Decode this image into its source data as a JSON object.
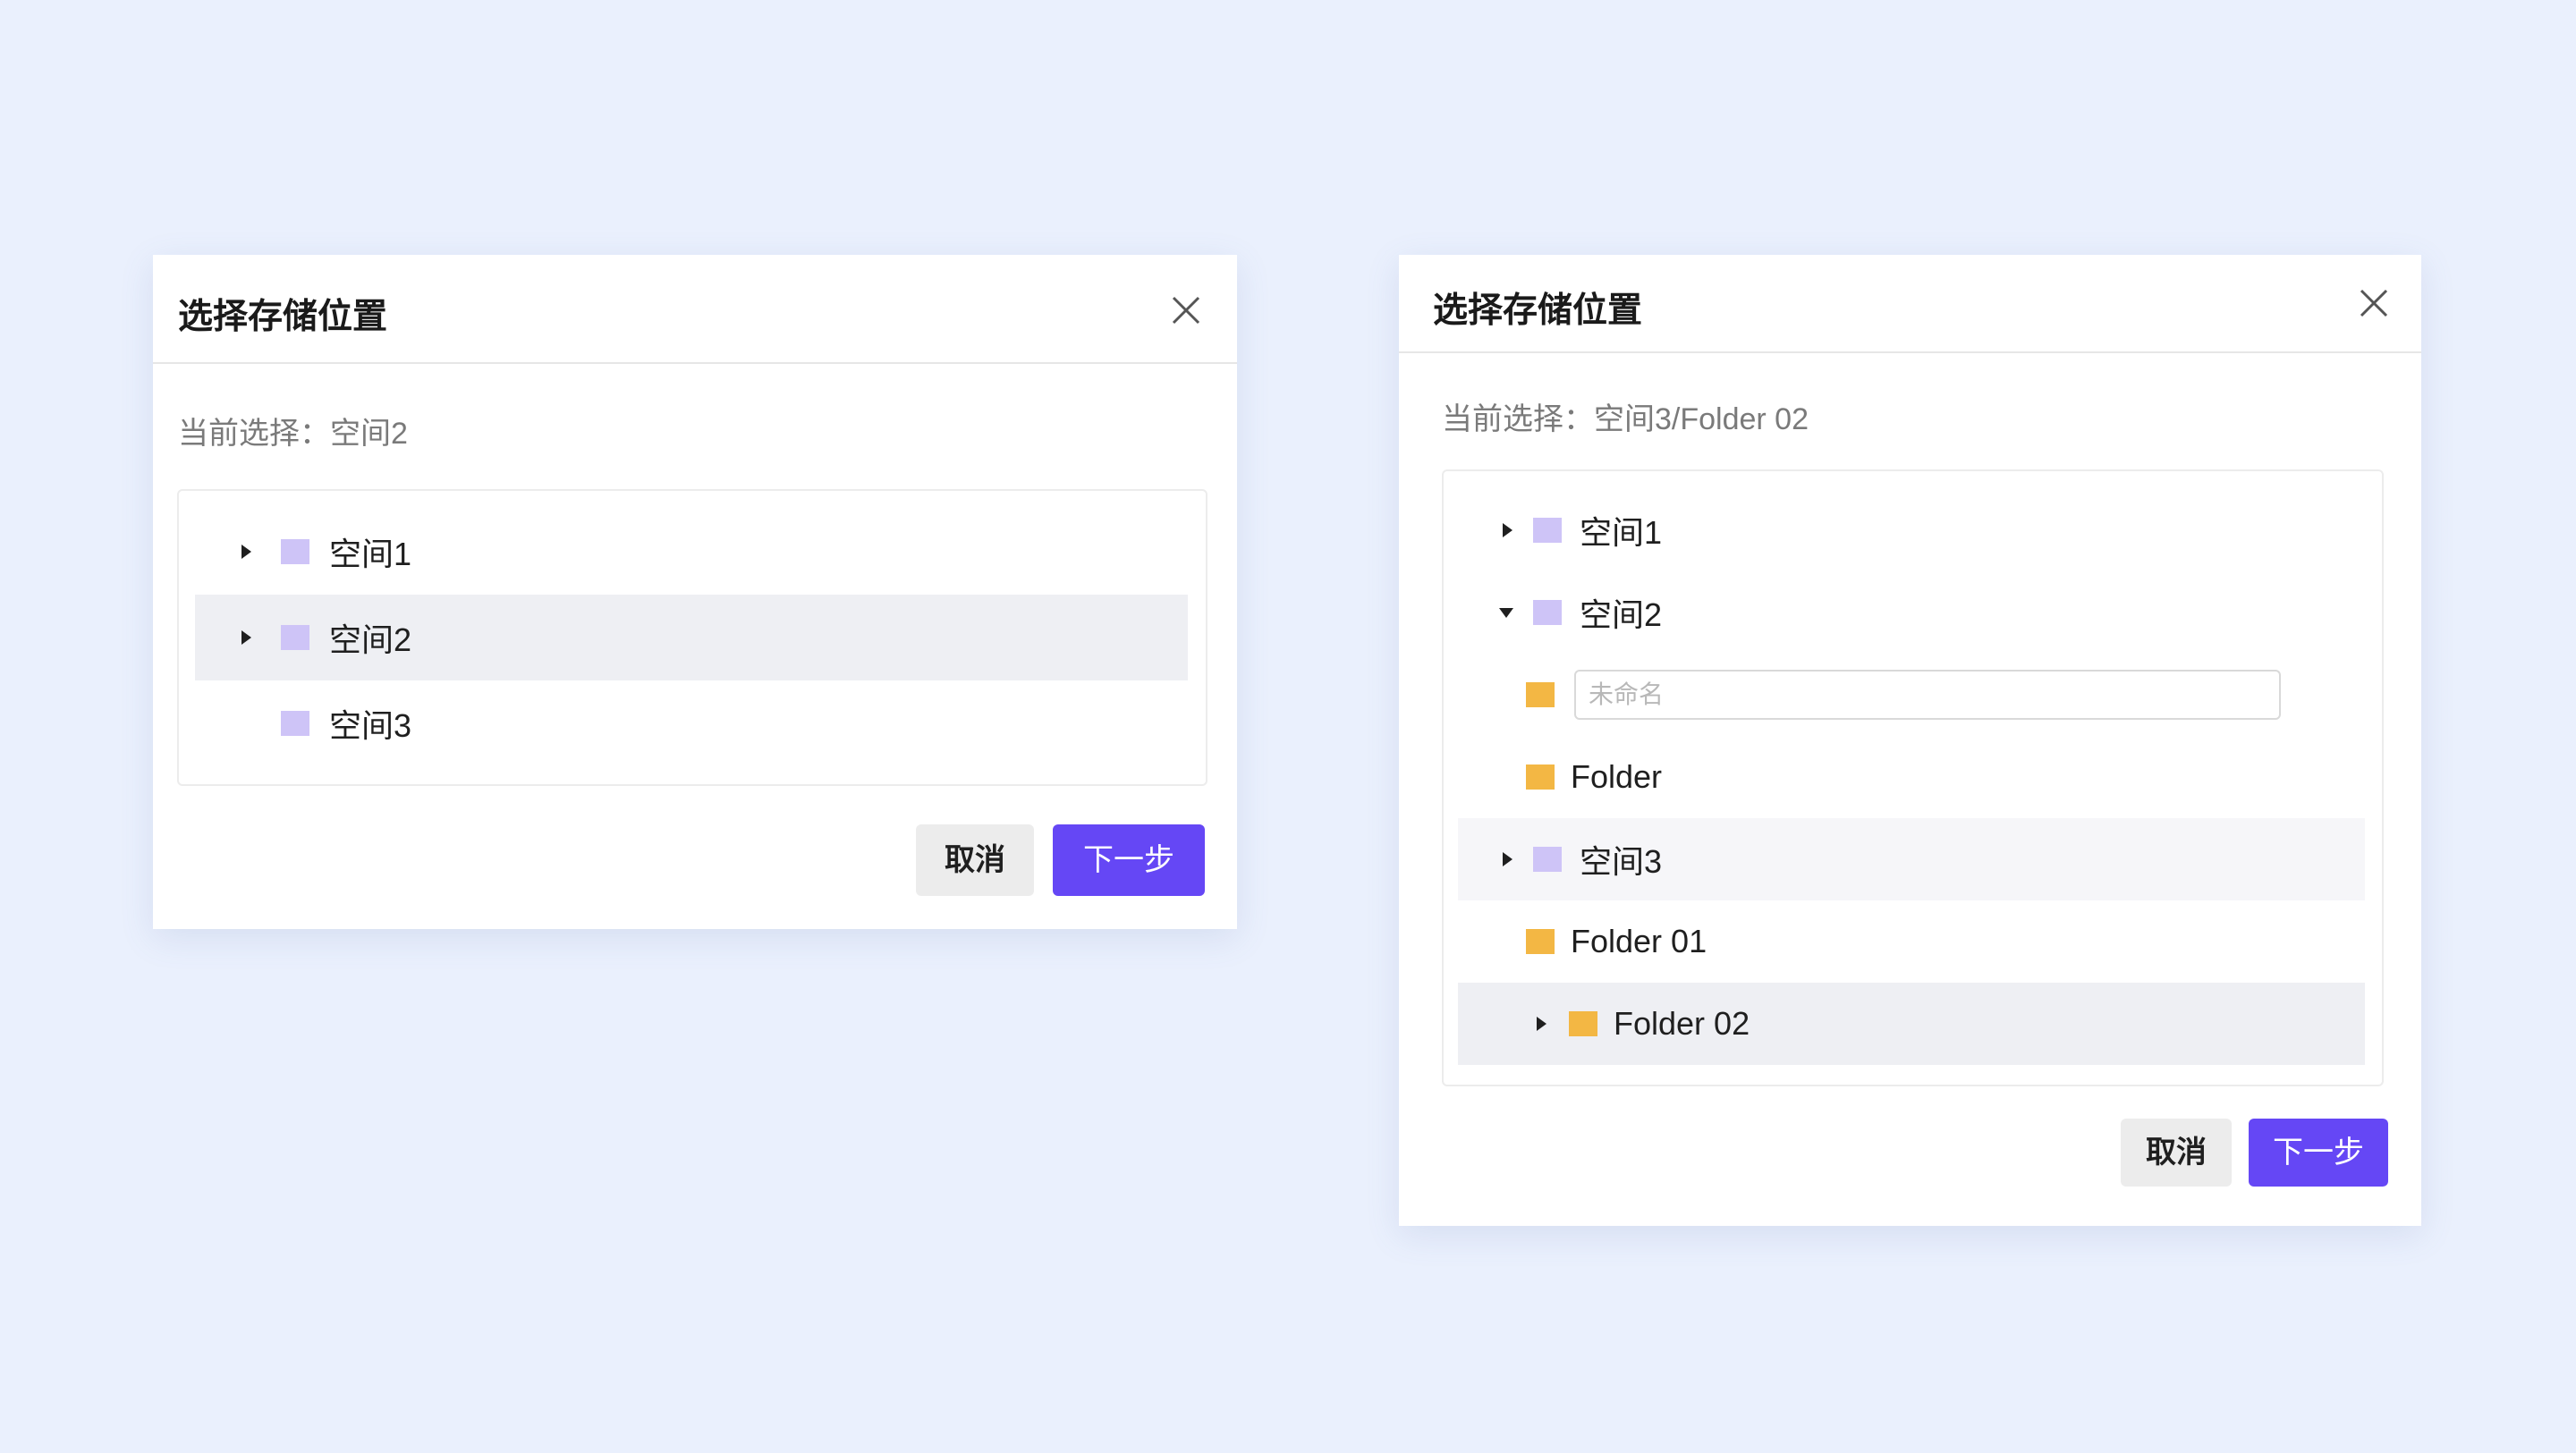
{
  "colors": {
    "page_background": "#eaf0fd",
    "primary": "#6547f5",
    "space_folder": "#cec4f7",
    "folder": "#f3b744",
    "selected_row": "#eeeff3"
  },
  "dialog_left": {
    "title": "选择存储位置",
    "close_icon": "close-icon",
    "current_selection": "当前选择：空间2",
    "tree": [
      {
        "label": "空间1",
        "expandable": true,
        "expanded": false,
        "icon": "space-folder-icon",
        "selected": false
      },
      {
        "label": "空间2",
        "expandable": true,
        "expanded": false,
        "icon": "space-folder-icon",
        "selected": true
      },
      {
        "label": "空间3",
        "expandable": false,
        "expanded": false,
        "icon": "space-folder-icon",
        "selected": false
      }
    ],
    "cancel_label": "取消",
    "next_label": "下一步"
  },
  "dialog_right": {
    "title": "选择存储位置",
    "close_icon": "close-icon",
    "current_selection": "当前选择：空间3/Folder 02",
    "tree": [
      {
        "label": "空间1",
        "expandable": true,
        "expanded": false,
        "icon": "space-folder-icon"
      },
      {
        "label": "空间2",
        "expandable": true,
        "expanded": true,
        "icon": "space-folder-icon"
      },
      {
        "new_folder_placeholder": "未命名",
        "icon": "folder-icon"
      },
      {
        "label": "Folder",
        "icon": "folder-icon"
      },
      {
        "label": "空间3",
        "expandable": true,
        "expanded": false,
        "icon": "space-folder-icon"
      },
      {
        "label": "Folder 01",
        "icon": "folder-icon"
      },
      {
        "label": "Folder 02",
        "expandable": true,
        "expanded": false,
        "icon": "folder-icon",
        "selected": true
      }
    ],
    "cancel_label": "取消",
    "next_label": "下一步"
  }
}
